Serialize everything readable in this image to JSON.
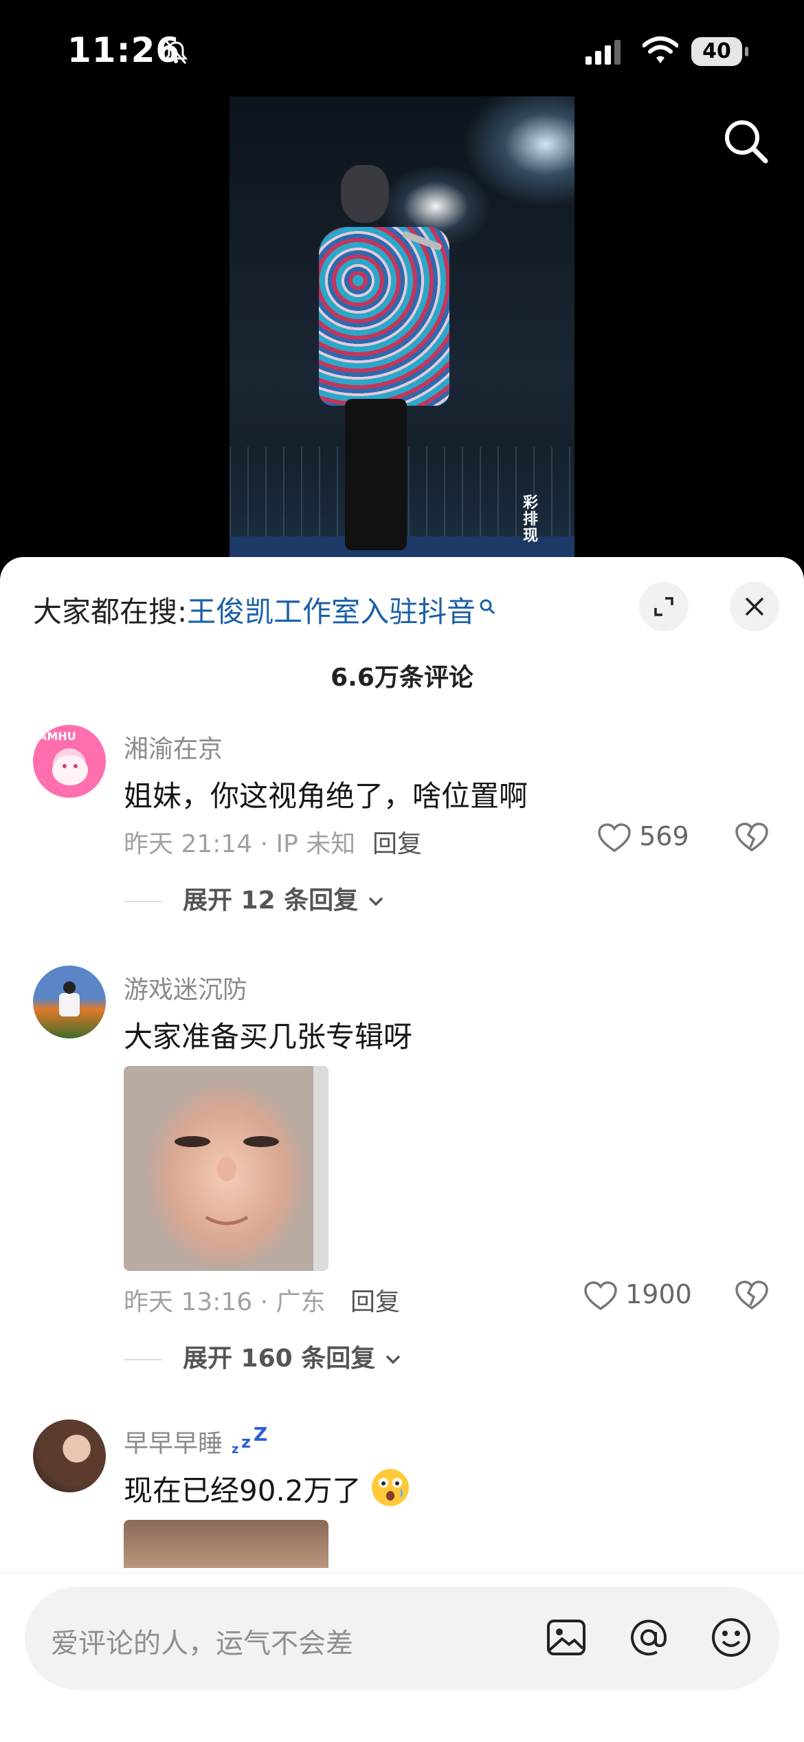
{
  "status_bar": {
    "time": "11:26",
    "battery": "40"
  },
  "video": {
    "watermark": "彩排现"
  },
  "sheet": {
    "hot_search_prefix": "大家都在搜:",
    "hot_search_query": "王俊凯工作室入驻抖音",
    "comment_count": "6.6万条评论"
  },
  "comments": [
    {
      "username": "湘渝在京",
      "text": "姐妹，你这视角绝了，啥位置啊",
      "meta": "昨天 21:14 · IP 未知",
      "reply_label": "回复",
      "likes": "569",
      "expand_label": "展开 12 条回复"
    },
    {
      "username": "游戏迷沉防",
      "text": "大家准备买几张专辑呀",
      "meta": "昨天 13:16 · 广东",
      "reply_label": "回复",
      "likes": "1900",
      "expand_label": "展开 160 条回复"
    },
    {
      "username": "早早早睡",
      "text": "现在已经90.2万了"
    }
  ],
  "input": {
    "placeholder": "爱评论的人，运气不会差"
  },
  "colors": {
    "link": "#1a5fa8",
    "zzz": "#2a5fd6"
  }
}
